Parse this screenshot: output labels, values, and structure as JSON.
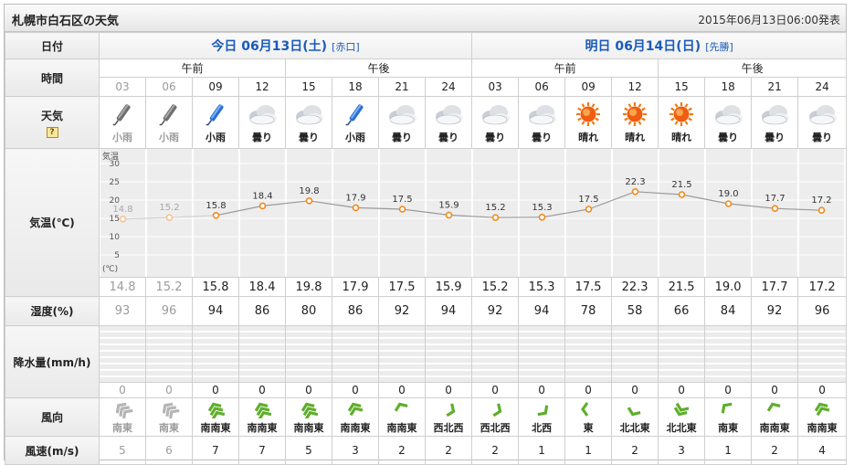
{
  "title": "札幌市白石区の天気",
  "issued": "2015年06月13日06:00発表",
  "labels": {
    "date": "日付",
    "time": "時間",
    "weather": "天気",
    "weather_help": "?",
    "temperature": "気温(℃)",
    "humidity": "湿度(%)",
    "precipitation": "降水量(mm/h)",
    "wind_dir": "風向",
    "wind_speed": "風速(m/s)"
  },
  "days": [
    {
      "label": "今日 06月13日(土)",
      "rokuyo": "[赤口]"
    },
    {
      "label": "明日 06月14日(日)",
      "rokuyo": "[先勝]"
    }
  ],
  "ampm": [
    "午前",
    "午後",
    "午前",
    "午後"
  ],
  "hours": [
    "03",
    "06",
    "09",
    "12",
    "15",
    "18",
    "21",
    "24",
    "03",
    "06",
    "09",
    "12",
    "15",
    "18",
    "21",
    "24"
  ],
  "past": [
    true,
    true,
    false,
    false,
    false,
    false,
    false,
    false,
    false,
    false,
    false,
    false,
    false,
    false,
    false,
    false
  ],
  "weather": [
    "小雨",
    "小雨",
    "小雨",
    "曇り",
    "曇り",
    "小雨",
    "曇り",
    "曇り",
    "曇り",
    "曇り",
    "晴れ",
    "晴れ",
    "晴れ",
    "曇り",
    "曇り",
    "曇り"
  ],
  "weather_icons": [
    "umbrella-closed-icon",
    "umbrella-closed-icon",
    "umbrella-icon",
    "cloud-icon",
    "cloud-icon",
    "umbrella-icon",
    "cloud-icon",
    "cloud-icon",
    "cloud-icon",
    "cloud-icon",
    "sun-icon",
    "sun-icon",
    "sun-icon",
    "cloud-icon",
    "cloud-icon",
    "cloud-icon"
  ],
  "humidity": [
    "93",
    "96",
    "94",
    "86",
    "80",
    "86",
    "92",
    "94",
    "92",
    "94",
    "78",
    "58",
    "66",
    "84",
    "92",
    "96"
  ],
  "precipitation": [
    "0",
    "0",
    "0",
    "0",
    "0",
    "0",
    "0",
    "0",
    "0",
    "0",
    "0",
    "0",
    "0",
    "0",
    "0",
    "0"
  ],
  "wind_dir": [
    "南東",
    "南東",
    "南南東",
    "南南東",
    "南南東",
    "南南東",
    "南南東",
    "西北西",
    "西北西",
    "北西",
    "東",
    "北北東",
    "北北東",
    "南東",
    "南南東",
    "南南東"
  ],
  "wind_speed": [
    "5",
    "6",
    "7",
    "7",
    "5",
    "3",
    "2",
    "2",
    "2",
    "1",
    "1",
    "2",
    "3",
    "1",
    "2",
    "4"
  ],
  "chart_data": {
    "type": "line",
    "x": [
      "03",
      "06",
      "09",
      "12",
      "15",
      "18",
      "21",
      "24",
      "03",
      "06",
      "09",
      "12",
      "15",
      "18",
      "21",
      "24"
    ],
    "values": [
      14.8,
      15.2,
      15.8,
      18.4,
      19.8,
      17.9,
      17.5,
      15.9,
      15.2,
      15.3,
      17.5,
      22.3,
      21.5,
      19.0,
      17.7,
      17.2
    ],
    "value_labels": [
      "14.8",
      "15.2",
      "15.8",
      "18.4",
      "19.8",
      "17.9",
      "17.5",
      "15.9",
      "15.2",
      "15.3",
      "17.5",
      "22.3",
      "21.5",
      "19.0",
      "17.7",
      "17.2"
    ],
    "ylabel": "気温",
    "yunit": "(℃)",
    "yticks": [
      "30",
      "25",
      "20",
      "15",
      "10",
      "5"
    ],
    "ylim": [
      0,
      33
    ],
    "grid": true
  },
  "colors": {
    "accent": "#1a5bb8",
    "line": "#9a9a9a",
    "marker": "#f08a1c",
    "past": "#9c9c9c",
    "wind_green": "#5fae2c",
    "wind_gray": "#b5b5b5"
  }
}
